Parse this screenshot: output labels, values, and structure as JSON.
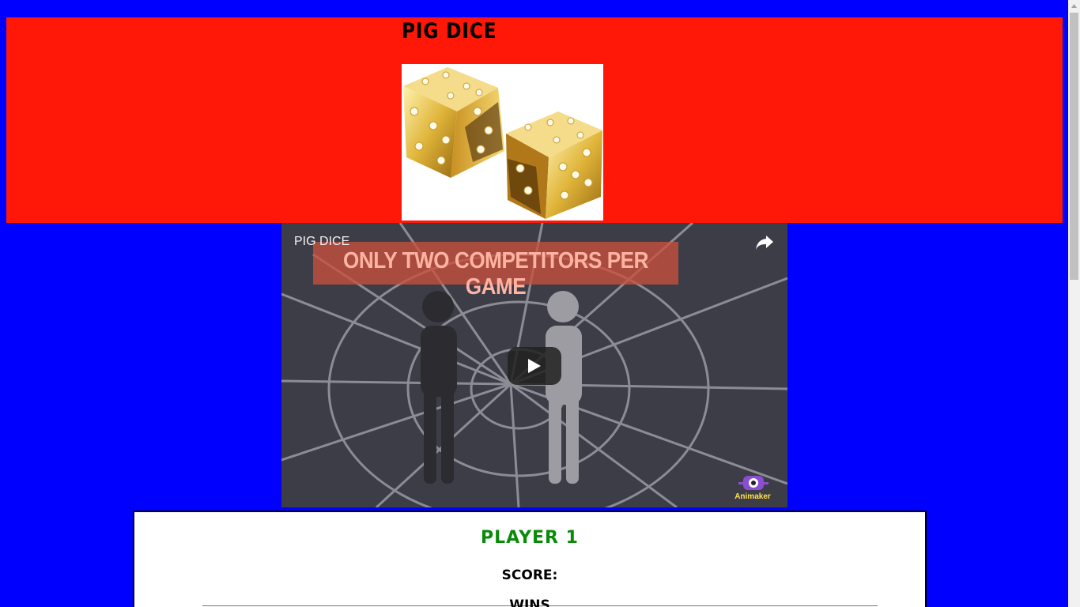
{
  "header": {
    "title": "PIG DICE",
    "image_name": "golden-dice-image"
  },
  "video": {
    "title": "PIG DICE",
    "banner_text": "ONLY TWO COMPETITORS PER GAME",
    "logo_text": "Animaker"
  },
  "player": {
    "name": "PLAYER 1",
    "score_label": "SCORE:",
    "wins_label": "WINS"
  },
  "colors": {
    "page_background": "#0000fe",
    "header_background": "#ff1807",
    "player_name": "#0a8a0a"
  }
}
